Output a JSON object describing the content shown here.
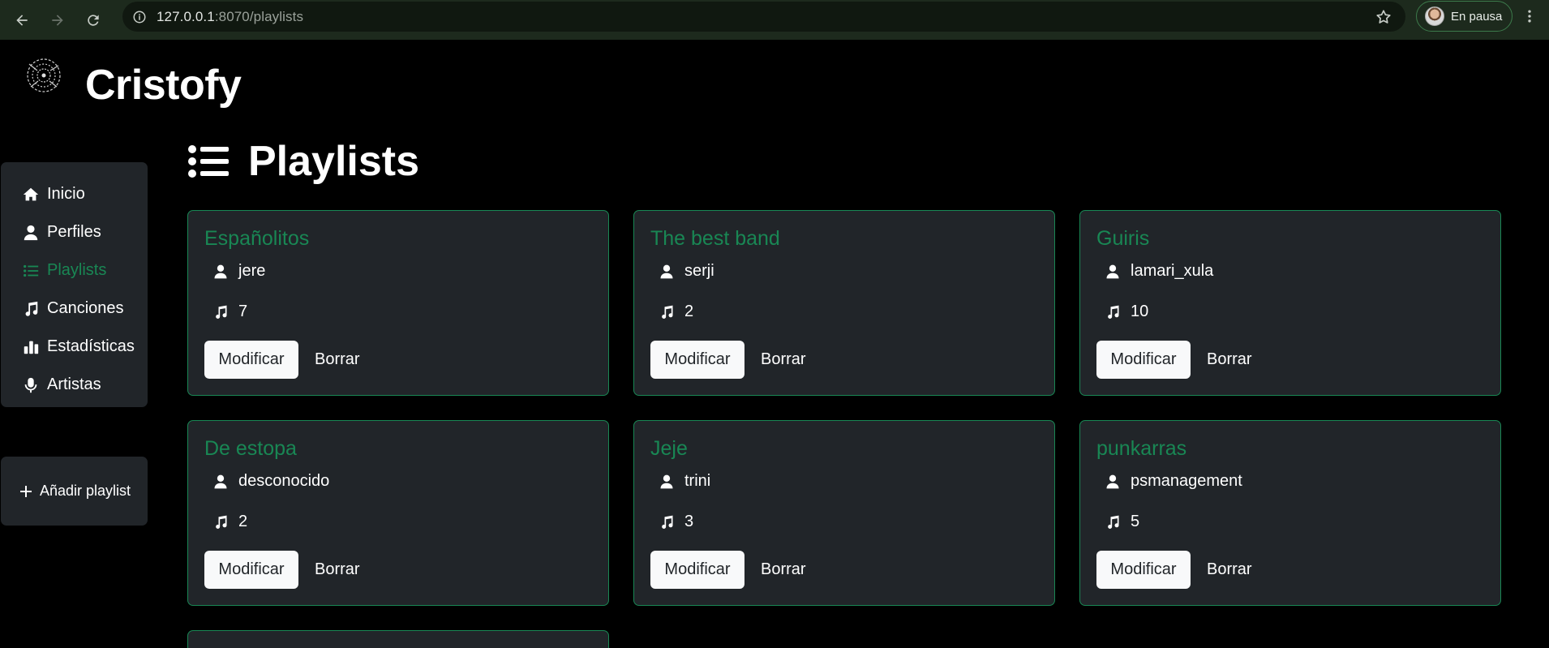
{
  "browser": {
    "url_host": "127.0.0.1",
    "url_rest": ":8070/playlists",
    "profile_label": "En pausa"
  },
  "app": {
    "name": "Cristofy"
  },
  "sidebar": {
    "items": [
      {
        "label": "Inicio",
        "icon": "home-icon",
        "active": false
      },
      {
        "label": "Perfiles",
        "icon": "person-icon",
        "active": false
      },
      {
        "label": "Playlists",
        "icon": "list-icon",
        "active": true
      },
      {
        "label": "Canciones",
        "icon": "music-note-icon",
        "active": false
      },
      {
        "label": "Estadísticas",
        "icon": "bar-chart-icon",
        "active": false
      },
      {
        "label": "Artistas",
        "icon": "microphone-icon",
        "active": false
      }
    ],
    "add_label": "Añadir playlist"
  },
  "main": {
    "title": "Playlists",
    "playlists": [
      {
        "name": "Españolitos",
        "owner": "jere",
        "songs": "7"
      },
      {
        "name": "The best band",
        "owner": "serji",
        "songs": "2"
      },
      {
        "name": "Guiris",
        "owner": "lamari_xula",
        "songs": "10"
      },
      {
        "name": "De estopa",
        "owner": "desconocido",
        "songs": "2"
      },
      {
        "name": "Jeje",
        "owner": "trini",
        "songs": "3"
      },
      {
        "name": "punkarras",
        "owner": "psmanagement",
        "songs": "5"
      }
    ],
    "modify_label": "Modificar",
    "delete_label": "Borrar"
  },
  "colors": {
    "accent": "#198754",
    "panel": "#212529",
    "background": "#000000"
  }
}
